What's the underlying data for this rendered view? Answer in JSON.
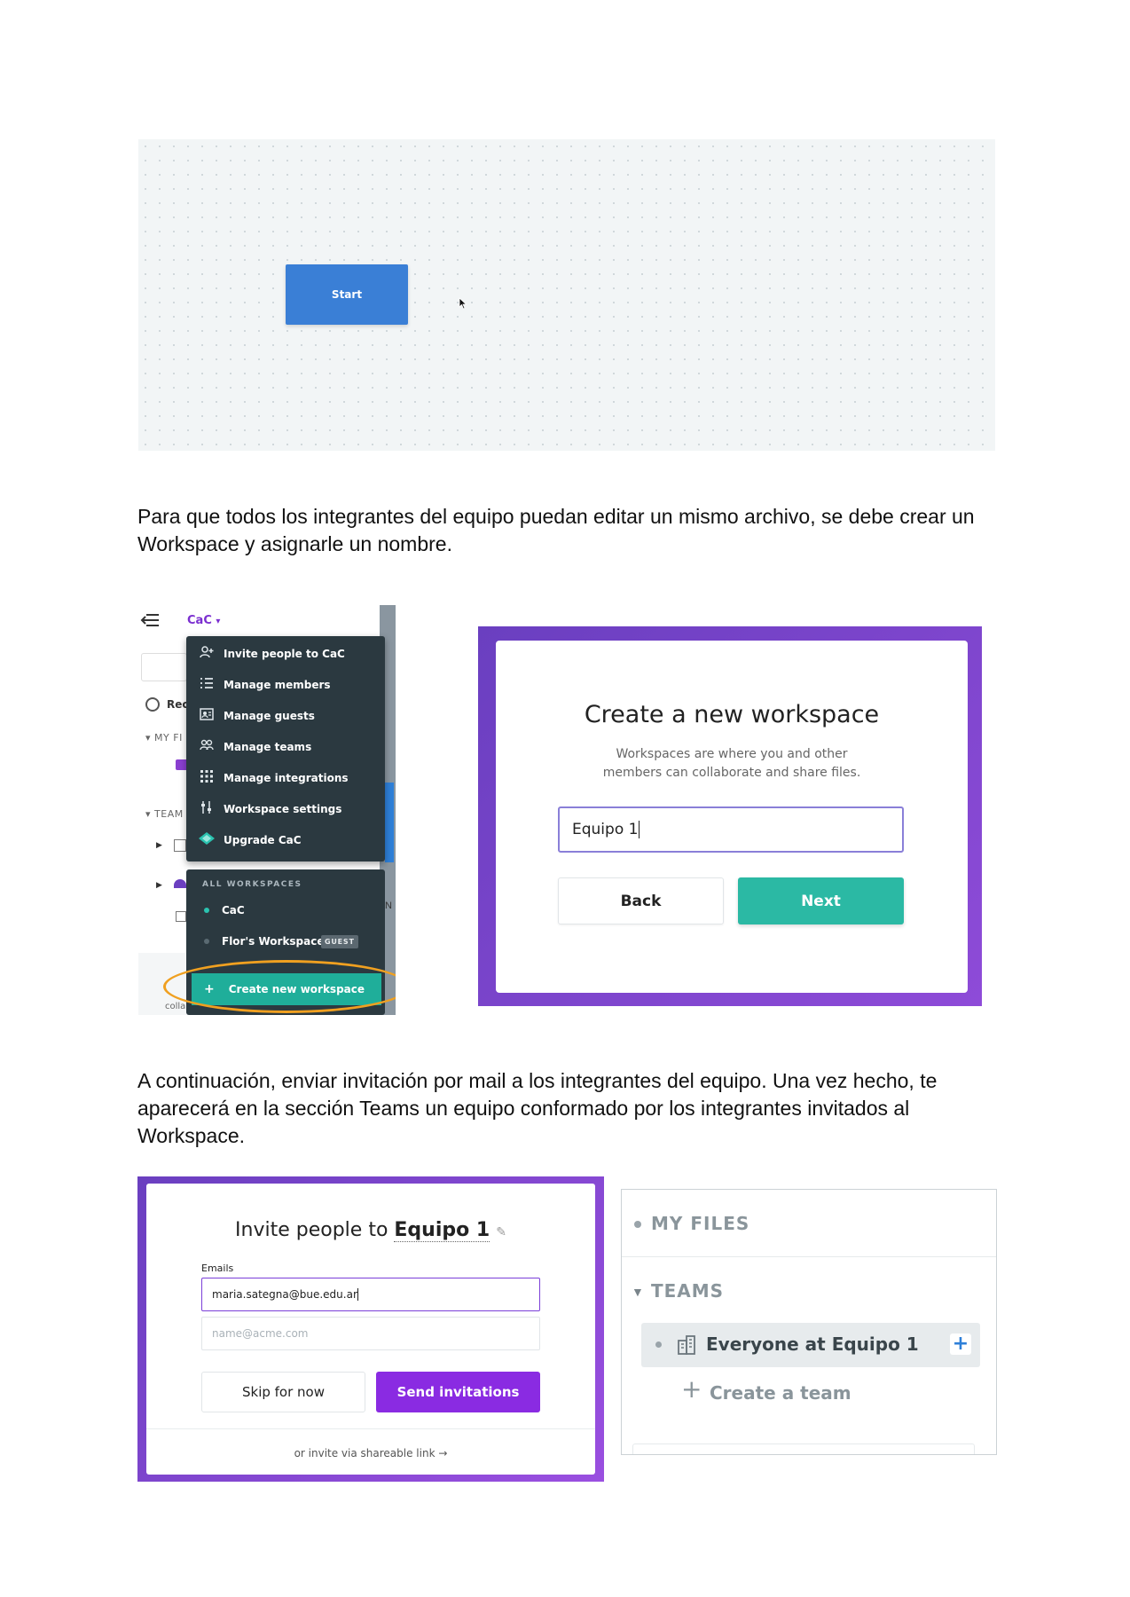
{
  "canvas": {
    "start_node_label": "Start"
  },
  "paragraphs": {
    "p1_line1": "Para que todos los integrantes del equipo puedan editar un mismo archivo, se debe crear un",
    "p1_line2": "Workspace y asignarle un nombre.",
    "p2_line1": "A continuación, enviar invitación por mail a los integrantes del equipo. Una vez hecho, te",
    "p2_line2": "aparecerá en la sección Teams un equipo conformado por los integrantes invitados al",
    "p2_line3": "Workspace."
  },
  "workspace_menu": {
    "workspace_name": "CaC",
    "sidebar_partial": {
      "recent": "Rec",
      "my_files": "MY FI",
      "teams": "TEAM",
      "bottom_text": "collaborative"
    },
    "items": [
      {
        "label": "Invite people to CaC",
        "icon": "person-plus-icon"
      },
      {
        "label": "Manage members",
        "icon": "list-icon"
      },
      {
        "label": "Manage guests",
        "icon": "id-card-icon"
      },
      {
        "label": "Manage teams",
        "icon": "people-icon"
      },
      {
        "label": "Manage integrations",
        "icon": "grid-icon"
      },
      {
        "label": "Workspace settings",
        "icon": "sliders-icon"
      },
      {
        "label": "Upgrade CaC",
        "icon": "diamond-icon"
      }
    ],
    "all_workspaces_header": "ALL WORKSPACES",
    "workspaces": [
      {
        "label": "CaC",
        "active": true
      },
      {
        "label": "Flor's Workspace",
        "badge": "GUEST",
        "active": false
      }
    ],
    "create_label": "Create new workspace",
    "highlight_color": "#f0a020"
  },
  "create_workspace": {
    "title": "Create a new workspace",
    "desc_line1": "Workspaces are where you and other",
    "desc_line2": "members can collaborate and share files.",
    "input_value": "Equipo 1",
    "back_label": "Back",
    "next_label": "Next",
    "accent": "#2bb9a4"
  },
  "invite": {
    "title_prefix": "Invite people to",
    "team_name": "Equipo 1",
    "emails_label": "Emails",
    "email_value": "maria.sategna@bue.edu.ar",
    "email_placeholder": "name@acme.com",
    "skip_label": "Skip for now",
    "send_label": "Send invitations",
    "link_text": "or invite via shareable link",
    "accent": "#8a2be2"
  },
  "teams_panel": {
    "my_files": "MY FILES",
    "teams": "TEAMS",
    "team_item": "Everyone at Equipo 1",
    "create_team": "Create a team"
  }
}
